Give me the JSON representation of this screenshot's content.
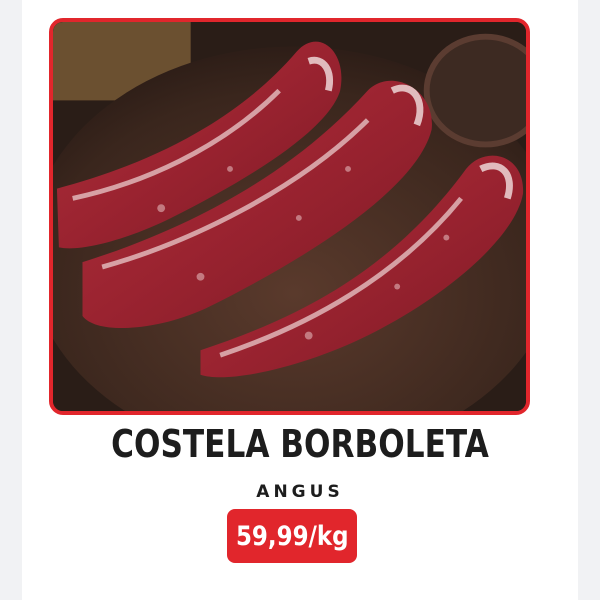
{
  "product": {
    "image_alt": "Costela borboleta angus",
    "name": "COSTELA BORBOLETA",
    "subtitle": "ANGUS",
    "price": "59,99/kg"
  },
  "colors": {
    "accent": "#e1262c",
    "text": "#1d1d1d",
    "background": "#ffffff"
  }
}
